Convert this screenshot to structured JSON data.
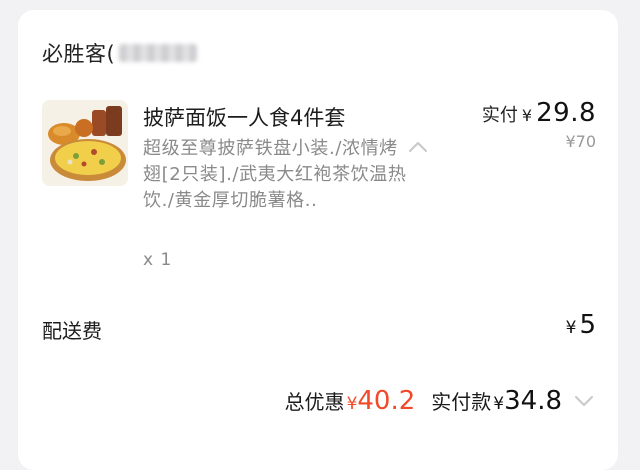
{
  "store": {
    "name": "必胜客("
  },
  "item": {
    "name": "披萨面饭一人食4件套",
    "description": "超级至尊披萨铁盘小装./浓情烤翅[2只装]./武夷大红袍茶饮温热饮./黄金厚切脆薯格..",
    "quantity": "x 1",
    "paid_label": "实付",
    "currency": "¥",
    "paid_value": "29.8",
    "original_price": "¥70",
    "image_icon": "pizza-combo-image"
  },
  "delivery": {
    "label": "配送费",
    "currency": "¥",
    "value": "5"
  },
  "summary": {
    "discount_label": "总优惠",
    "discount_currency": "¥",
    "discount_value": "40.2",
    "total_label": "实付款",
    "total_currency": "¥",
    "total_value": "34.8"
  },
  "colors": {
    "accent": "#f04a2a",
    "muted": "#8a8a8a",
    "background": "#f2f2f4"
  }
}
